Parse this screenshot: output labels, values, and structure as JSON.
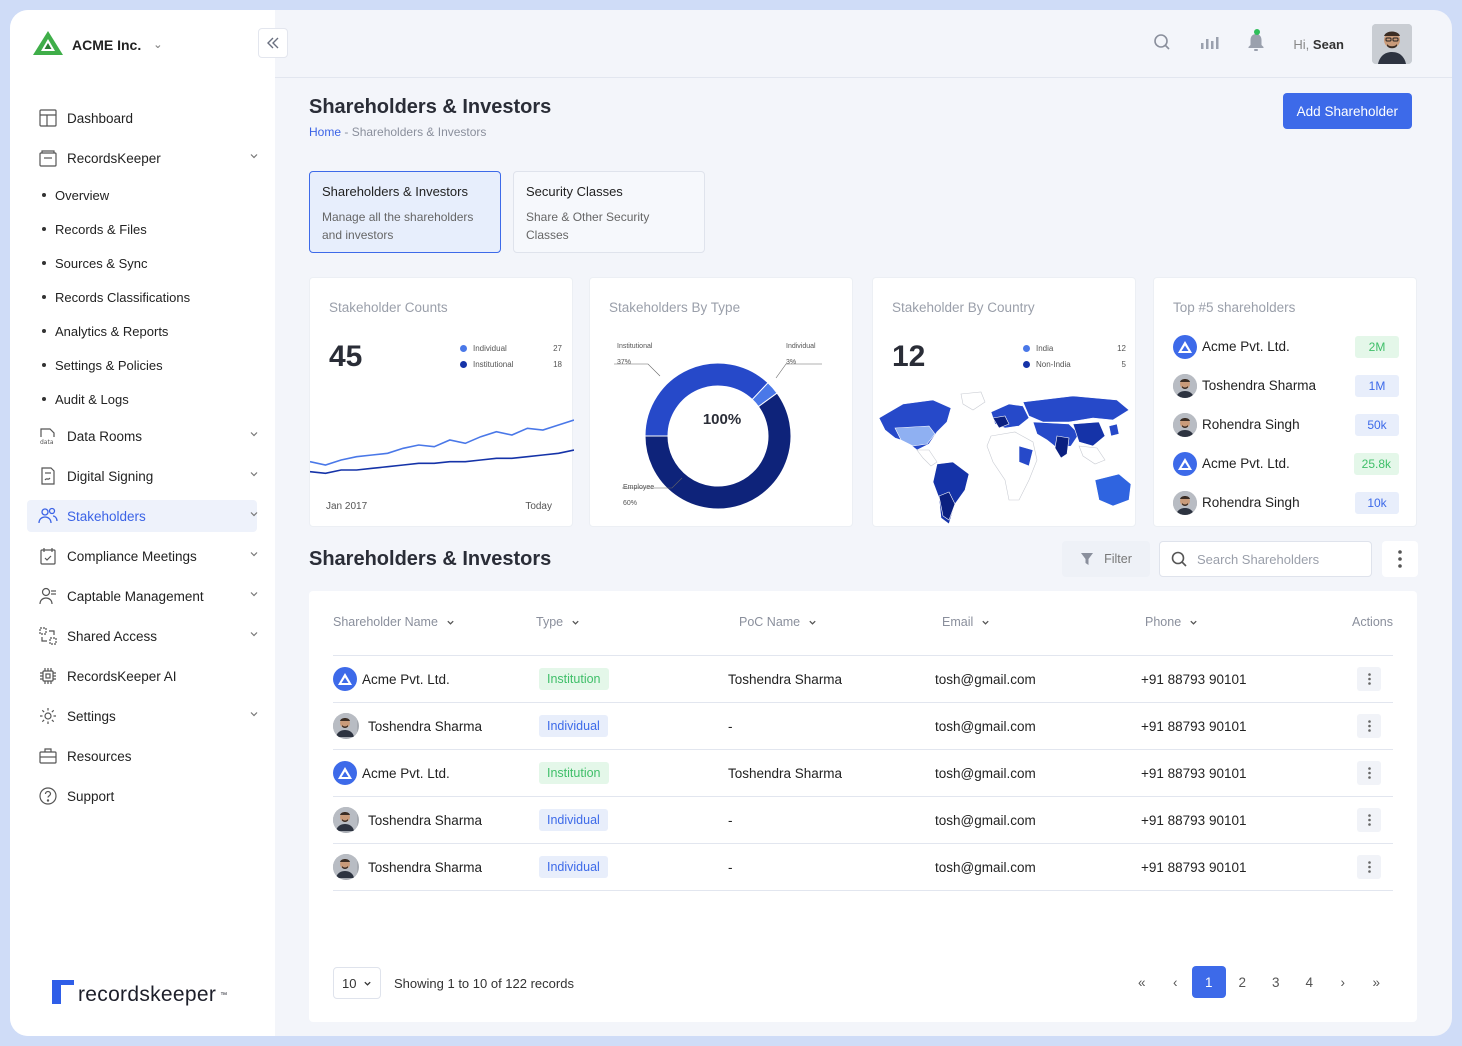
{
  "brand": {
    "name": "ACME Inc."
  },
  "sidebar": {
    "items": [
      {
        "label": "Dashboard",
        "icon": "dashboard-icon"
      },
      {
        "label": "RecordsKeeper",
        "icon": "recordskeeper-icon"
      },
      {
        "label": "Data Rooms",
        "icon": "data-rooms-icon"
      },
      {
        "label": "Digital Signing",
        "icon": "digital-signing-icon"
      },
      {
        "label": "Stakeholders",
        "icon": "stakeholders-icon"
      },
      {
        "label": "Compliance Meetings",
        "icon": "compliance-meetings-icon"
      },
      {
        "label": "Captable Management",
        "icon": "captable-icon"
      },
      {
        "label": "Shared Access",
        "icon": "shared-access-icon"
      },
      {
        "label": "RecordsKeeper AI",
        "icon": "ai-chip-icon"
      },
      {
        "label": "Settings",
        "icon": "gear-icon"
      },
      {
        "label": "Resources",
        "icon": "briefcase-icon"
      },
      {
        "label": "Support",
        "icon": "help-icon"
      }
    ],
    "subitems": [
      "Overview",
      "Records & Files",
      "Sources & Sync",
      "Records Classifications",
      "Analytics & Reports",
      "Settings & Policies",
      "Audit & Logs"
    ],
    "footer_logo": "recordskeeper",
    "footer_tm": "™"
  },
  "header": {
    "greeting_prefix": "Hi,",
    "user": "Sean"
  },
  "page": {
    "title": "Shareholders & Investors",
    "breadcrumb_home": "Home",
    "breadcrumb_sep": " - ",
    "breadcrumb_current": "Shareholders & Investors",
    "add_button": "Add Shareholder"
  },
  "tabs": [
    {
      "title": "Shareholders & Investors",
      "desc": "Manage all the shareholders and investors"
    },
    {
      "title": "Security Classes",
      "desc": "Share & Other Security Classes"
    }
  ],
  "cards": {
    "counts": {
      "title": "Stakeholder Counts",
      "total": "45",
      "legend": [
        {
          "label": "Individual",
          "value": "27",
          "color": "#4a78e8"
        },
        {
          "label": "Institutional",
          "value": "18",
          "color": "#1533a8"
        }
      ],
      "x_start": "Jan 2017",
      "x_end": "Today"
    },
    "by_type": {
      "title": "Stakeholders By Type",
      "center": "100%",
      "labels": [
        {
          "name": "Institutional",
          "pct": "37%"
        },
        {
          "name": "Individual",
          "pct": "3%"
        },
        {
          "name": "Employee",
          "pct": "60%"
        }
      ]
    },
    "by_country": {
      "title": "Stakeholder By Country",
      "total": "12",
      "legend": [
        {
          "label": "India",
          "value": "12",
          "color": "#4a78e8"
        },
        {
          "label": "Non-India",
          "value": "5",
          "color": "#1533a8"
        }
      ]
    },
    "top5": {
      "title": "Top #5 shareholders",
      "rows": [
        {
          "name": "Acme Pvt. Ltd.",
          "value": "2M",
          "kind": "logo",
          "color": "green"
        },
        {
          "name": "Toshendra Sharma",
          "value": "1M",
          "kind": "pic",
          "color": "blue"
        },
        {
          "name": "Rohendra Singh",
          "value": "50k",
          "kind": "pic",
          "color": "blue"
        },
        {
          "name": "Acme Pvt. Ltd.",
          "value": "25.8k",
          "kind": "logo",
          "color": "green"
        },
        {
          "name": "Rohendra Singh",
          "value": "10k",
          "kind": "pic",
          "color": "blue"
        }
      ]
    }
  },
  "chart_data": [
    {
      "type": "line",
      "title": "Stakeholder Counts",
      "series": [
        {
          "name": "Individual",
          "values": [
            20,
            18,
            21,
            23,
            24,
            25,
            28,
            30,
            29,
            33,
            31,
            35,
            38,
            36,
            40,
            39,
            42,
            45
          ]
        },
        {
          "name": "Institutional",
          "values": [
            14,
            13,
            15,
            15,
            16,
            17,
            18,
            19,
            19,
            20,
            20,
            21,
            22,
            22,
            23,
            24,
            25,
            27
          ]
        }
      ],
      "ylim": [
        0,
        60
      ]
    },
    {
      "type": "pie",
      "title": "Stakeholders By Type",
      "categories": [
        "Institutional",
        "Individual",
        "Employee"
      ],
      "values": [
        37,
        3,
        60
      ]
    }
  ],
  "section": {
    "title": "Shareholders & Investors",
    "filter": "Filter",
    "search_placeholder": "Search Shareholders"
  },
  "table": {
    "columns": [
      "Shareholder Name",
      "Type",
      "PoC Name",
      "Email",
      "Phone",
      "Actions"
    ],
    "rows": [
      {
        "name": "Acme Pvt. Ltd.",
        "kind": "logo",
        "type": "Institution",
        "poc": "Toshendra Sharma",
        "email": "tosh@gmail.com",
        "phone": "+91 88793 90101"
      },
      {
        "name": "Toshendra Sharma",
        "kind": "pic",
        "type": "Individual",
        "poc": "-",
        "email": "tosh@gmail.com",
        "phone": "+91 88793 90101"
      },
      {
        "name": "Acme Pvt. Ltd.",
        "kind": "logo",
        "type": "Institution",
        "poc": "Toshendra Sharma",
        "email": "tosh@gmail.com",
        "phone": "+91 88793 90101"
      },
      {
        "name": "Toshendra Sharma",
        "kind": "pic",
        "type": "Individual",
        "poc": "-",
        "email": "tosh@gmail.com",
        "phone": "+91 88793 90101"
      },
      {
        "name": "Toshendra Sharma",
        "kind": "pic",
        "type": "Individual",
        "poc": "-",
        "email": "tosh@gmail.com",
        "phone": "+91 88793 90101"
      }
    ]
  },
  "pagination": {
    "page_size": "10",
    "summary": "Showing 1 to 10 of 122 records",
    "first": "«",
    "prev": "‹",
    "pages": [
      "1",
      "2",
      "3",
      "4"
    ],
    "next": "›",
    "last": "»",
    "current": "1"
  },
  "colors": {
    "accent": "#3d6ae9",
    "dark_blue": "#1533a8",
    "green": "#3fbf69"
  }
}
